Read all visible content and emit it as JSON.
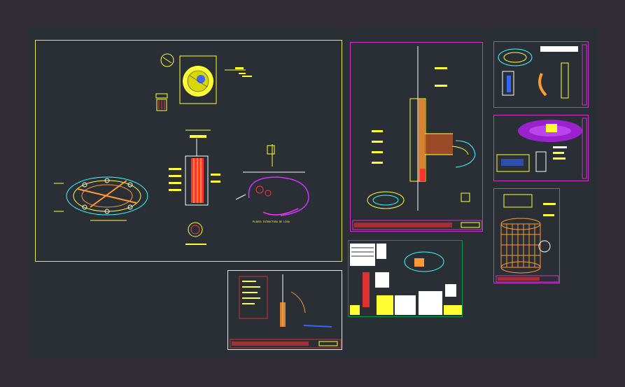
{
  "drawing": {
    "background_color": "#302d36",
    "modelspace_color": "#2a2f35",
    "sheets": [
      {
        "id": "main-layout",
        "border_color": "#ffff66"
      },
      {
        "id": "elevation-sheet",
        "border_color": "#cc33cc"
      },
      {
        "id": "plan-detail-sheet",
        "border_color": "#cc33cc"
      },
      {
        "id": "platform-sheet",
        "border_color": "#cc33cc"
      },
      {
        "id": "stair-3d-sheet",
        "border_color": "#cc33cc"
      },
      {
        "id": "notes-sheet",
        "border_color": "#ffffff"
      },
      {
        "id": "schedule-sheet",
        "border_color": "#00aa44"
      }
    ],
    "labels": {
      "plan_caption": "PLANTA ESTRUCTURA DE LOSA"
    },
    "colors": {
      "yellow": "#ffff33",
      "red": "#ff3333",
      "cyan": "#33ffff",
      "magenta": "#ff33ff",
      "orange": "#ff9933",
      "white": "#ffffff",
      "green": "#33ff66",
      "blue": "#3366ff"
    }
  }
}
